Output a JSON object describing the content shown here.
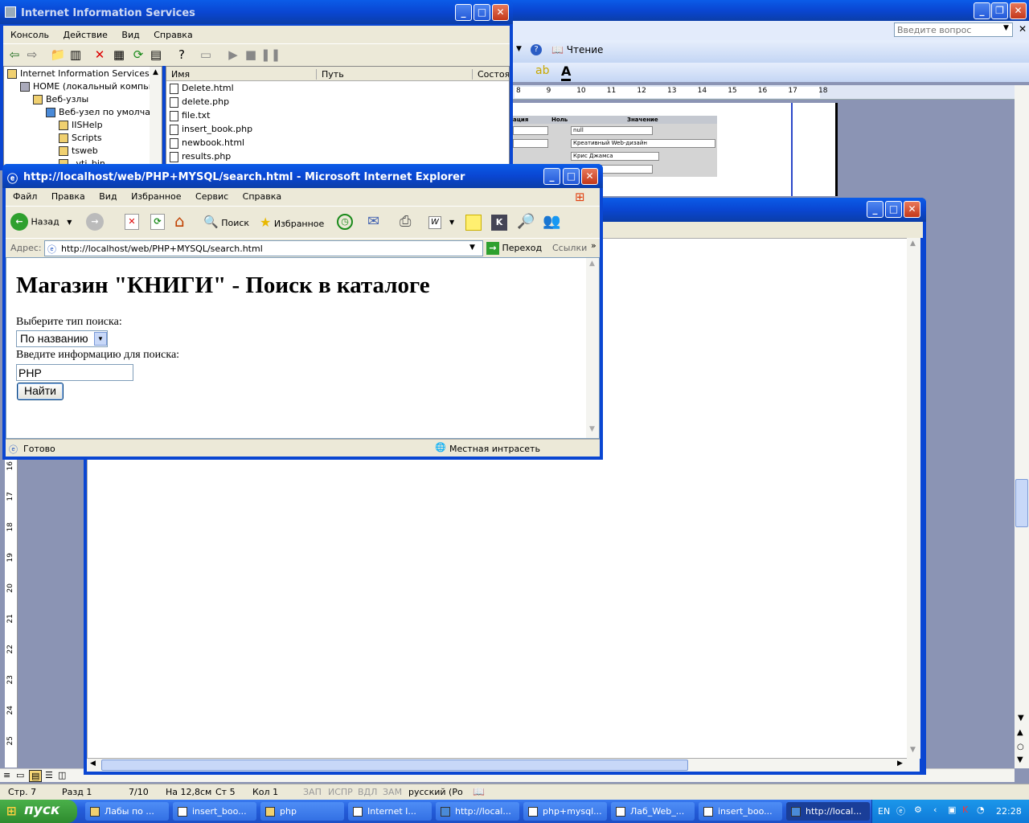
{
  "iis": {
    "title": "Internet Information Services",
    "menu": [
      "Консоль",
      "Действие",
      "Вид",
      "Справка"
    ],
    "tree": [
      {
        "label": "Internet Information Services",
        "level": 0
      },
      {
        "label": "HOME (локальный компьют",
        "level": 1
      },
      {
        "label": "Веб-узлы",
        "level": 2
      },
      {
        "label": "Веб-узел по умолчан",
        "level": 3
      },
      {
        "label": "IISHelp",
        "level": 4
      },
      {
        "label": "Scripts",
        "level": 4
      },
      {
        "label": "tsweb",
        "level": 4
      },
      {
        "label": "_vti_bin",
        "level": 4
      }
    ],
    "columns": [
      "Имя",
      "Путь",
      "Состоян"
    ],
    "files": [
      "Delete.html",
      "delete.php",
      "file.txt",
      "insert_book.php",
      "newbook.html",
      "results.php"
    ]
  },
  "word": {
    "reading_label": "Чтение",
    "ask_placeholder": "Введите вопрос",
    "ruler_labels": [
      "8",
      "9",
      "10",
      "11",
      "12",
      "13",
      "14",
      "15",
      "16",
      "17",
      "18"
    ],
    "vruler_labels": [
      "16",
      "17",
      "18",
      "19",
      "20",
      "21",
      "22",
      "23",
      "24",
      "25"
    ],
    "table": {
      "headers": [
        "ация",
        "Ноль",
        "Значение"
      ],
      "values": [
        "null",
        "Креативный Web-дизайн",
        "Крис Джамса",
        ""
      ]
    },
    "status": {
      "page": "Стр. 7",
      "section": "Разд 1",
      "pages": "7/10",
      "at": "На 12,8см",
      "line": "Ст 5",
      "col": "Кол 1",
      "rec": "ЗАП",
      "trk": "ИСПР",
      "ext": "ВДЛ",
      "ovr": "ЗАМ",
      "lang": "русский (Ро"
    }
  },
  "ie": {
    "title": "http://localhost/web/PHP+MYSQL/search.html - Microsoft Internet Explorer",
    "menu": [
      "Файл",
      "Правка",
      "Вид",
      "Избранное",
      "Сервис",
      "Справка"
    ],
    "back_label": "Назад",
    "search_label": "Поиск",
    "favorites_label": "Избранное",
    "address_label": "Адрес:",
    "address": "http://localhost/web/PHP+MYSQL/search.html",
    "go_label": "Переход",
    "links_label": "Ссылки",
    "page": {
      "heading": "Магазин \"КНИГИ\" - Поиск в каталоге",
      "type_label": "Выберите тип поиска:",
      "type_value": "По названию",
      "info_label": "Введите информацию для поиска:",
      "search_value": "PHP",
      "button": "Найти"
    },
    "status_text": "Готово",
    "zone": "Местная интрасеть"
  },
  "taskbar": {
    "start": "пуск",
    "items": [
      "Лабы по ...",
      "insert_boo...",
      "php",
      "Internet I...",
      "http://local...",
      "php+mysql...",
      "Лаб_Web_...",
      "insert_boo...",
      "http://local..."
    ],
    "lang": "EN",
    "clock": "22:28"
  }
}
